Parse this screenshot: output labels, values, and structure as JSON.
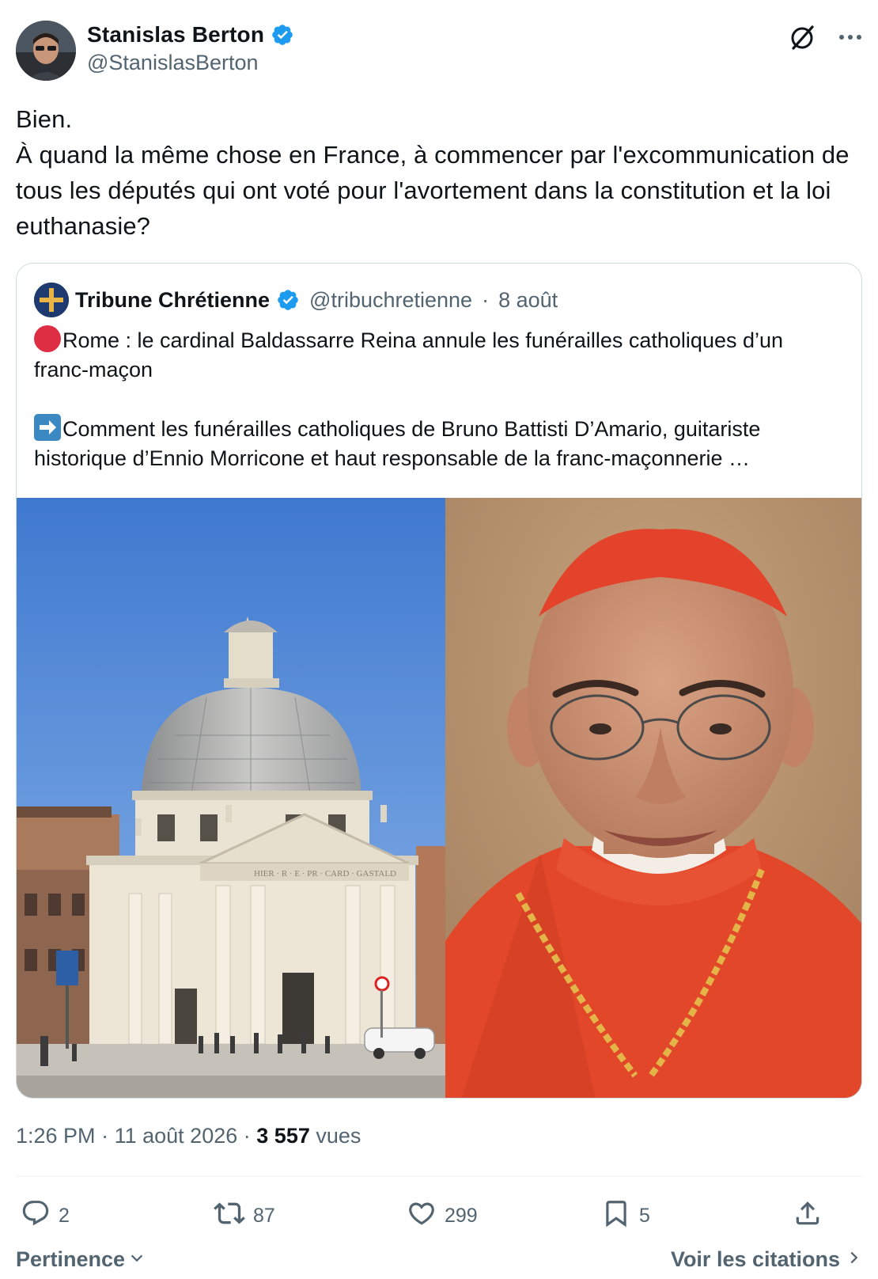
{
  "author": {
    "display_name": "Stanislas Berton",
    "handle": "@StanislasBerton",
    "verified": true
  },
  "header_icons": [
    "grok-icon",
    "more-icon"
  ],
  "tweet": {
    "text": "Bien.\nÀ quand la même chose en France, à commencer par l'excommunication de tous les députés qui ont voté pour l'avortement dans la constitution et la loi euthanasie?"
  },
  "quote": {
    "display_name": "Tribune Chrétienne",
    "handle": "@tribuchretienne",
    "separator": "·",
    "date": "8 août",
    "paragraph1": "Rome : le cardinal Baldassarre Reina annule les funérailles catholiques d’un franc-maçon",
    "paragraph2": "Comment les funérailles catholiques de Bruno Battisti D’Amario, guitariste historique d’Ennio Morricone et haut responsable de la franc-maçonnerie …",
    "facade_inscription": "HIER · R · E · PR · CARD · GASTALD"
  },
  "meta": {
    "time": "1:26 PM",
    "sep1": "·",
    "date": "11 août 2026",
    "sep2": "·",
    "views_count": "3 557",
    "views_label": "vues"
  },
  "actions": {
    "replies": "2",
    "reposts": "87",
    "likes": "299",
    "bookmarks": "5"
  },
  "footer": {
    "sort_label": "Pertinence",
    "quotes_link": "Voir les citations"
  },
  "colors": {
    "text_primary": "#0f1419",
    "text_secondary": "#536471",
    "verified_blue": "#1d9bf0",
    "border": "#cfd9de"
  }
}
